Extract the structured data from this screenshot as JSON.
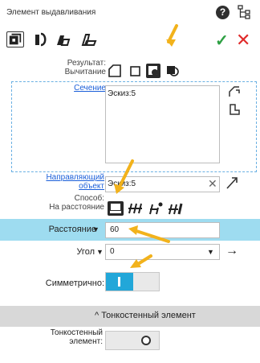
{
  "window": {
    "title": "Элемент выдавливания"
  },
  "header_icons": {
    "help": "help-icon",
    "tree": "tree-icon",
    "help_glyph": "?"
  },
  "toolbar": {
    "modes": [
      "extrude-icon",
      "rotate-icon",
      "kinematic-icon",
      "loft-icon"
    ],
    "ok_glyph": "✓",
    "cancel_glyph": "✕"
  },
  "result": {
    "label_line1": "Результат:",
    "label_line2": "Вычитание",
    "options": [
      "shape-outline-icon",
      "square-icon",
      "subtract-icon",
      "intersect-icon"
    ]
  },
  "section": {
    "label": "Сечение",
    "items": [
      "Эскиз:5"
    ],
    "icons": [
      "sketch-select-icon",
      "sketch-edit-icon"
    ]
  },
  "direction": {
    "label_line1": "Направляющий",
    "label_line2": "объект",
    "value": "Эскиз:5",
    "clear_glyph": "✕"
  },
  "method": {
    "label_line1": "Способ:",
    "label_line2": "На расстояние",
    "options": [
      "distance-icon",
      "through-all-icon",
      "to-vertex-icon",
      "to-surface-icon"
    ]
  },
  "distance": {
    "label": "Расстояние",
    "caret": "▼",
    "value": "60"
  },
  "angle": {
    "label": "Угол",
    "caret": "▼",
    "value": "0",
    "dropdown_glyph": "▼",
    "arrow_glyph": "→"
  },
  "symmetric": {
    "label": "Симметрично:",
    "state": "on"
  },
  "thin_wall": {
    "title": "^ Тонкостенный элемент",
    "label_line1": "Тонкостенный",
    "label_line2": "элемент:",
    "state": "off"
  },
  "colors": {
    "accent": "#22a7d9",
    "row_highlight": "#9edcf0",
    "annotation": "#f2b21b",
    "ok": "#2ea043",
    "cancel": "#e02a2a",
    "link": "#1b5fd9"
  }
}
